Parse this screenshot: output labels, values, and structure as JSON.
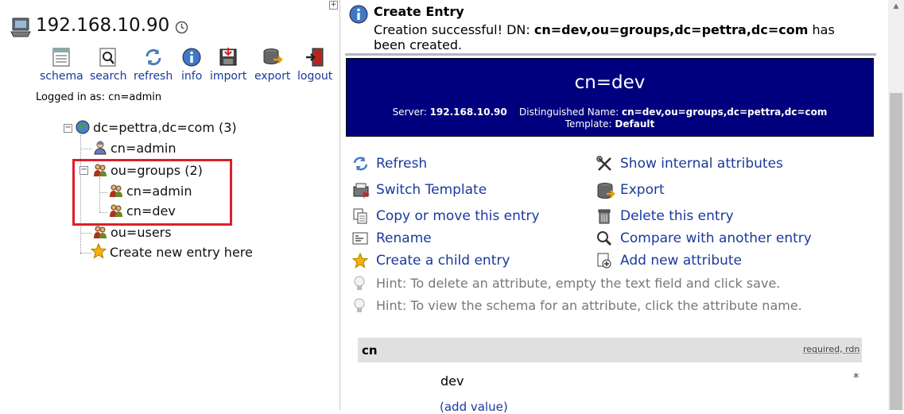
{
  "left": {
    "server": "192.168.10.90",
    "toolbar": [
      {
        "label": "schema",
        "icon": "schema-icon"
      },
      {
        "label": "search",
        "icon": "search-icon"
      },
      {
        "label": "refresh",
        "icon": "refresh-icon"
      },
      {
        "label": "info",
        "icon": "info-icon"
      },
      {
        "label": "import",
        "icon": "import-icon"
      },
      {
        "label": "export",
        "icon": "export-icon"
      },
      {
        "label": "logout",
        "icon": "logout-icon"
      }
    ],
    "logged_in": "Logged in as: cn=admin",
    "tree": {
      "root_part1": "dc=pettra",
      "root_comma": ",",
      "root_part2": "dc=com (3)",
      "cn_admin": "cn=admin",
      "ou_groups": "ou=groups (2)",
      "groups_admin": "cn=admin",
      "groups_dev": "cn=dev",
      "ou_users": "ou=users",
      "create_new": "Create new entry here"
    }
  },
  "message": {
    "title": "Create Entry",
    "text_prefix": "Creation successful! DN: ",
    "dn": "cn=dev,ou=groups,dc=pettra,dc=com",
    "text_suffix": " has been created."
  },
  "banner": {
    "title": "cn=dev",
    "server_label": "Server:",
    "server_value": "192.168.10.90",
    "dn_label": "Distinguished Name:",
    "dn_value": "cn=dev,ou=groups,dc=pettra,dc=com",
    "template_label": "Template:",
    "template_value": "Default"
  },
  "actions": {
    "refresh": "Refresh",
    "show_internal": "Show internal attributes",
    "switch_template": "Switch Template",
    "export": "Export",
    "copy_move": "Copy or move this entry",
    "delete": "Delete this entry",
    "rename": "Rename",
    "compare": "Compare with another entry",
    "create_child": "Create a child entry",
    "add_attribute": "Add new attribute"
  },
  "hints": {
    "hint1": "Hint: To delete an attribute, empty the text field and click save.",
    "hint2": "Hint: To view the schema for an attribute, click the attribute name."
  },
  "attribute": {
    "name": "cn",
    "flags": "required, rdn",
    "value": "dev",
    "required_mark": "*",
    "add_value": "(add value)"
  },
  "colors": {
    "banner_bg": "#00007f",
    "link": "#1a3a9a",
    "highlight": "#dd1f2a",
    "hint": "#777777"
  }
}
